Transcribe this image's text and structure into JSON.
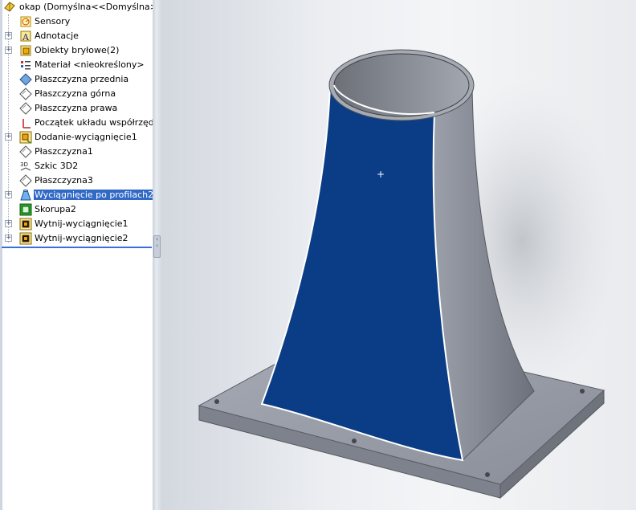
{
  "feature_tree": {
    "root_label": "okap  (Domyślna<<Domyślna>_St",
    "items": [
      {
        "label": "Sensory",
        "icon": "sensor-icon",
        "expandable": false,
        "selected": false
      },
      {
        "label": "Adnotacje",
        "icon": "annotation-icon",
        "expandable": true,
        "selected": false
      },
      {
        "label": "Obiekty bryłowe(2)",
        "icon": "solid-bodies-icon",
        "expandable": true,
        "selected": false
      },
      {
        "label": "Materiał <nieokreślony>",
        "icon": "material-icon",
        "expandable": false,
        "selected": false
      },
      {
        "label": "Płaszczyzna przednia",
        "icon": "front-plane-icon",
        "expandable": false,
        "selected": false
      },
      {
        "label": "Płaszczyzna górna",
        "icon": "plane-icon",
        "expandable": false,
        "selected": false
      },
      {
        "label": "Płaszczyzna prawa",
        "icon": "plane-icon",
        "expandable": false,
        "selected": false
      },
      {
        "label": "Początek układu współrzędnych",
        "icon": "origin-icon",
        "expandable": false,
        "selected": false
      },
      {
        "label": "Dodanie-wyciągnięcie1",
        "icon": "extrude-boss-icon",
        "expandable": true,
        "selected": false
      },
      {
        "label": "Płaszczyzna1",
        "icon": "plane-icon",
        "expandable": false,
        "selected": false
      },
      {
        "label": "Szkic 3D2",
        "icon": "sketch-3d-icon",
        "expandable": false,
        "selected": false
      },
      {
        "label": "Płaszczyzna3",
        "icon": "plane-icon",
        "expandable": false,
        "selected": false
      },
      {
        "label": "Wyciągnięcie po profilach2",
        "icon": "loft-icon",
        "expandable": true,
        "selected": true
      },
      {
        "label": "Skorupa2",
        "icon": "shell-icon",
        "expandable": false,
        "selected": false
      },
      {
        "label": "Wytnij-wyciągnięcie1",
        "icon": "extrude-cut-icon",
        "expandable": true,
        "selected": false
      },
      {
        "label": "Wytnij-wyciągnięcie2",
        "icon": "extrude-cut-icon",
        "expandable": true,
        "selected": false
      }
    ],
    "expand_symbol": "+"
  },
  "colors": {
    "selection": "#3169c6",
    "selected_face": "#0a3d86",
    "model_gray": "#8f939d",
    "rollback_bar": "#3a6fd8"
  },
  "viewport": {
    "cursor_symbol": "+"
  }
}
